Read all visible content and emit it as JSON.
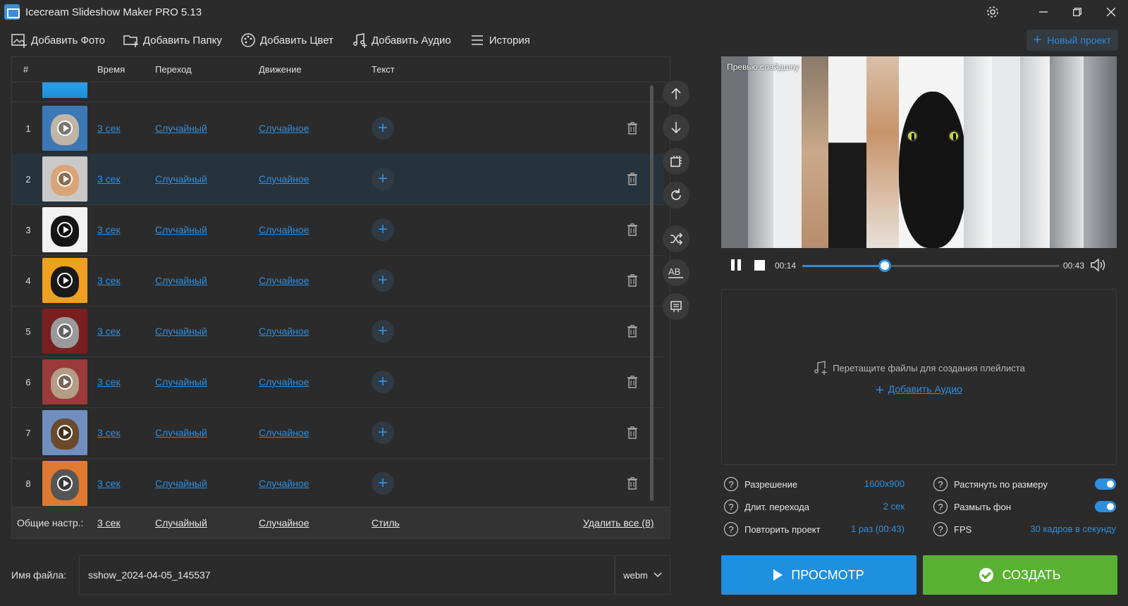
{
  "window": {
    "title": "Icecream Slideshow Maker PRO 5.13"
  },
  "toolbar": {
    "add_photo": "Добавить Фото",
    "add_folder": "Добавить Папку",
    "add_color": "Добавить Цвет",
    "add_audio": "Добавить Аудио",
    "history": "История",
    "new_project": "Новый проект"
  },
  "table": {
    "headers": {
      "num": "#",
      "time": "Время",
      "transition": "Переход",
      "motion": "Движение",
      "text": "Текст"
    },
    "rows": [
      {
        "num": "1",
        "time": "3 сек",
        "transition": "Случайный",
        "motion": "Случайное",
        "bg": "#3b78b5",
        "face": "#bfb6a8"
      },
      {
        "num": "2",
        "time": "3 сек",
        "transition": "Случайный",
        "motion": "Случайное",
        "bg": "#c9c9c9",
        "face": "#d9a577"
      },
      {
        "num": "3",
        "time": "3 сек",
        "transition": "Случайный",
        "motion": "Случайное",
        "bg": "#f2f2f2",
        "face": "#151515"
      },
      {
        "num": "4",
        "time": "3 сек",
        "transition": "Случайный",
        "motion": "Случайное",
        "bg": "#f0a020",
        "face": "#1a1a1a"
      },
      {
        "num": "5",
        "time": "3 сек",
        "transition": "Случайный",
        "motion": "Случайное",
        "bg": "#7a1f1f",
        "face": "#9a9a9a"
      },
      {
        "num": "6",
        "time": "3 сек",
        "transition": "Случайный",
        "motion": "Случайное",
        "bg": "#9a3a3a",
        "face": "#b59c86"
      },
      {
        "num": "7",
        "time": "3 сек",
        "transition": "Случайный",
        "motion": "Случайное",
        "bg": "#6f8fc0",
        "face": "#6a4a2a"
      },
      {
        "num": "8",
        "time": "3 сек",
        "transition": "Случайный",
        "motion": "Случайное",
        "bg": "#e07a30",
        "face": "#555555"
      }
    ],
    "selected_row": "2",
    "footer": {
      "label": "Общие настр.:",
      "time": "3 сек",
      "transition": "Случайный",
      "motion": "Случайное",
      "style": "Стиль",
      "delete_all": "Удалить все (8)"
    }
  },
  "preview": {
    "label": "Превью слайдшоу",
    "current_time": "00:14",
    "total_time": "00:43",
    "progress": 0.32
  },
  "playlist": {
    "hint": "Перетащите файлы для создания плейлиста",
    "add_audio": "Добавить Аудио"
  },
  "settings": {
    "resolution_label": "Разрешение",
    "resolution_value": "1600x900",
    "transition_duration_label": "Длит. перехода",
    "transition_duration_value": "2 сек",
    "repeat_label": "Повторить проект",
    "repeat_value": "1 раз (00:43)",
    "stretch_label": "Растянуть по размеру",
    "stretch_on": true,
    "blur_label": "Размыть фон",
    "blur_on": true,
    "fps_label": "FPS",
    "fps_value": "30 кадров в секунду"
  },
  "file": {
    "label": "Имя файла:",
    "name": "sshow_2024-04-05_145537",
    "format": "webm"
  },
  "actions": {
    "preview": "ПРОСМОТР",
    "create": "СОЗДАТЬ"
  },
  "colors": {
    "accent": "#2d8fe0",
    "create_green": "#5ab033",
    "preview_blue": "#1f8fe0"
  }
}
